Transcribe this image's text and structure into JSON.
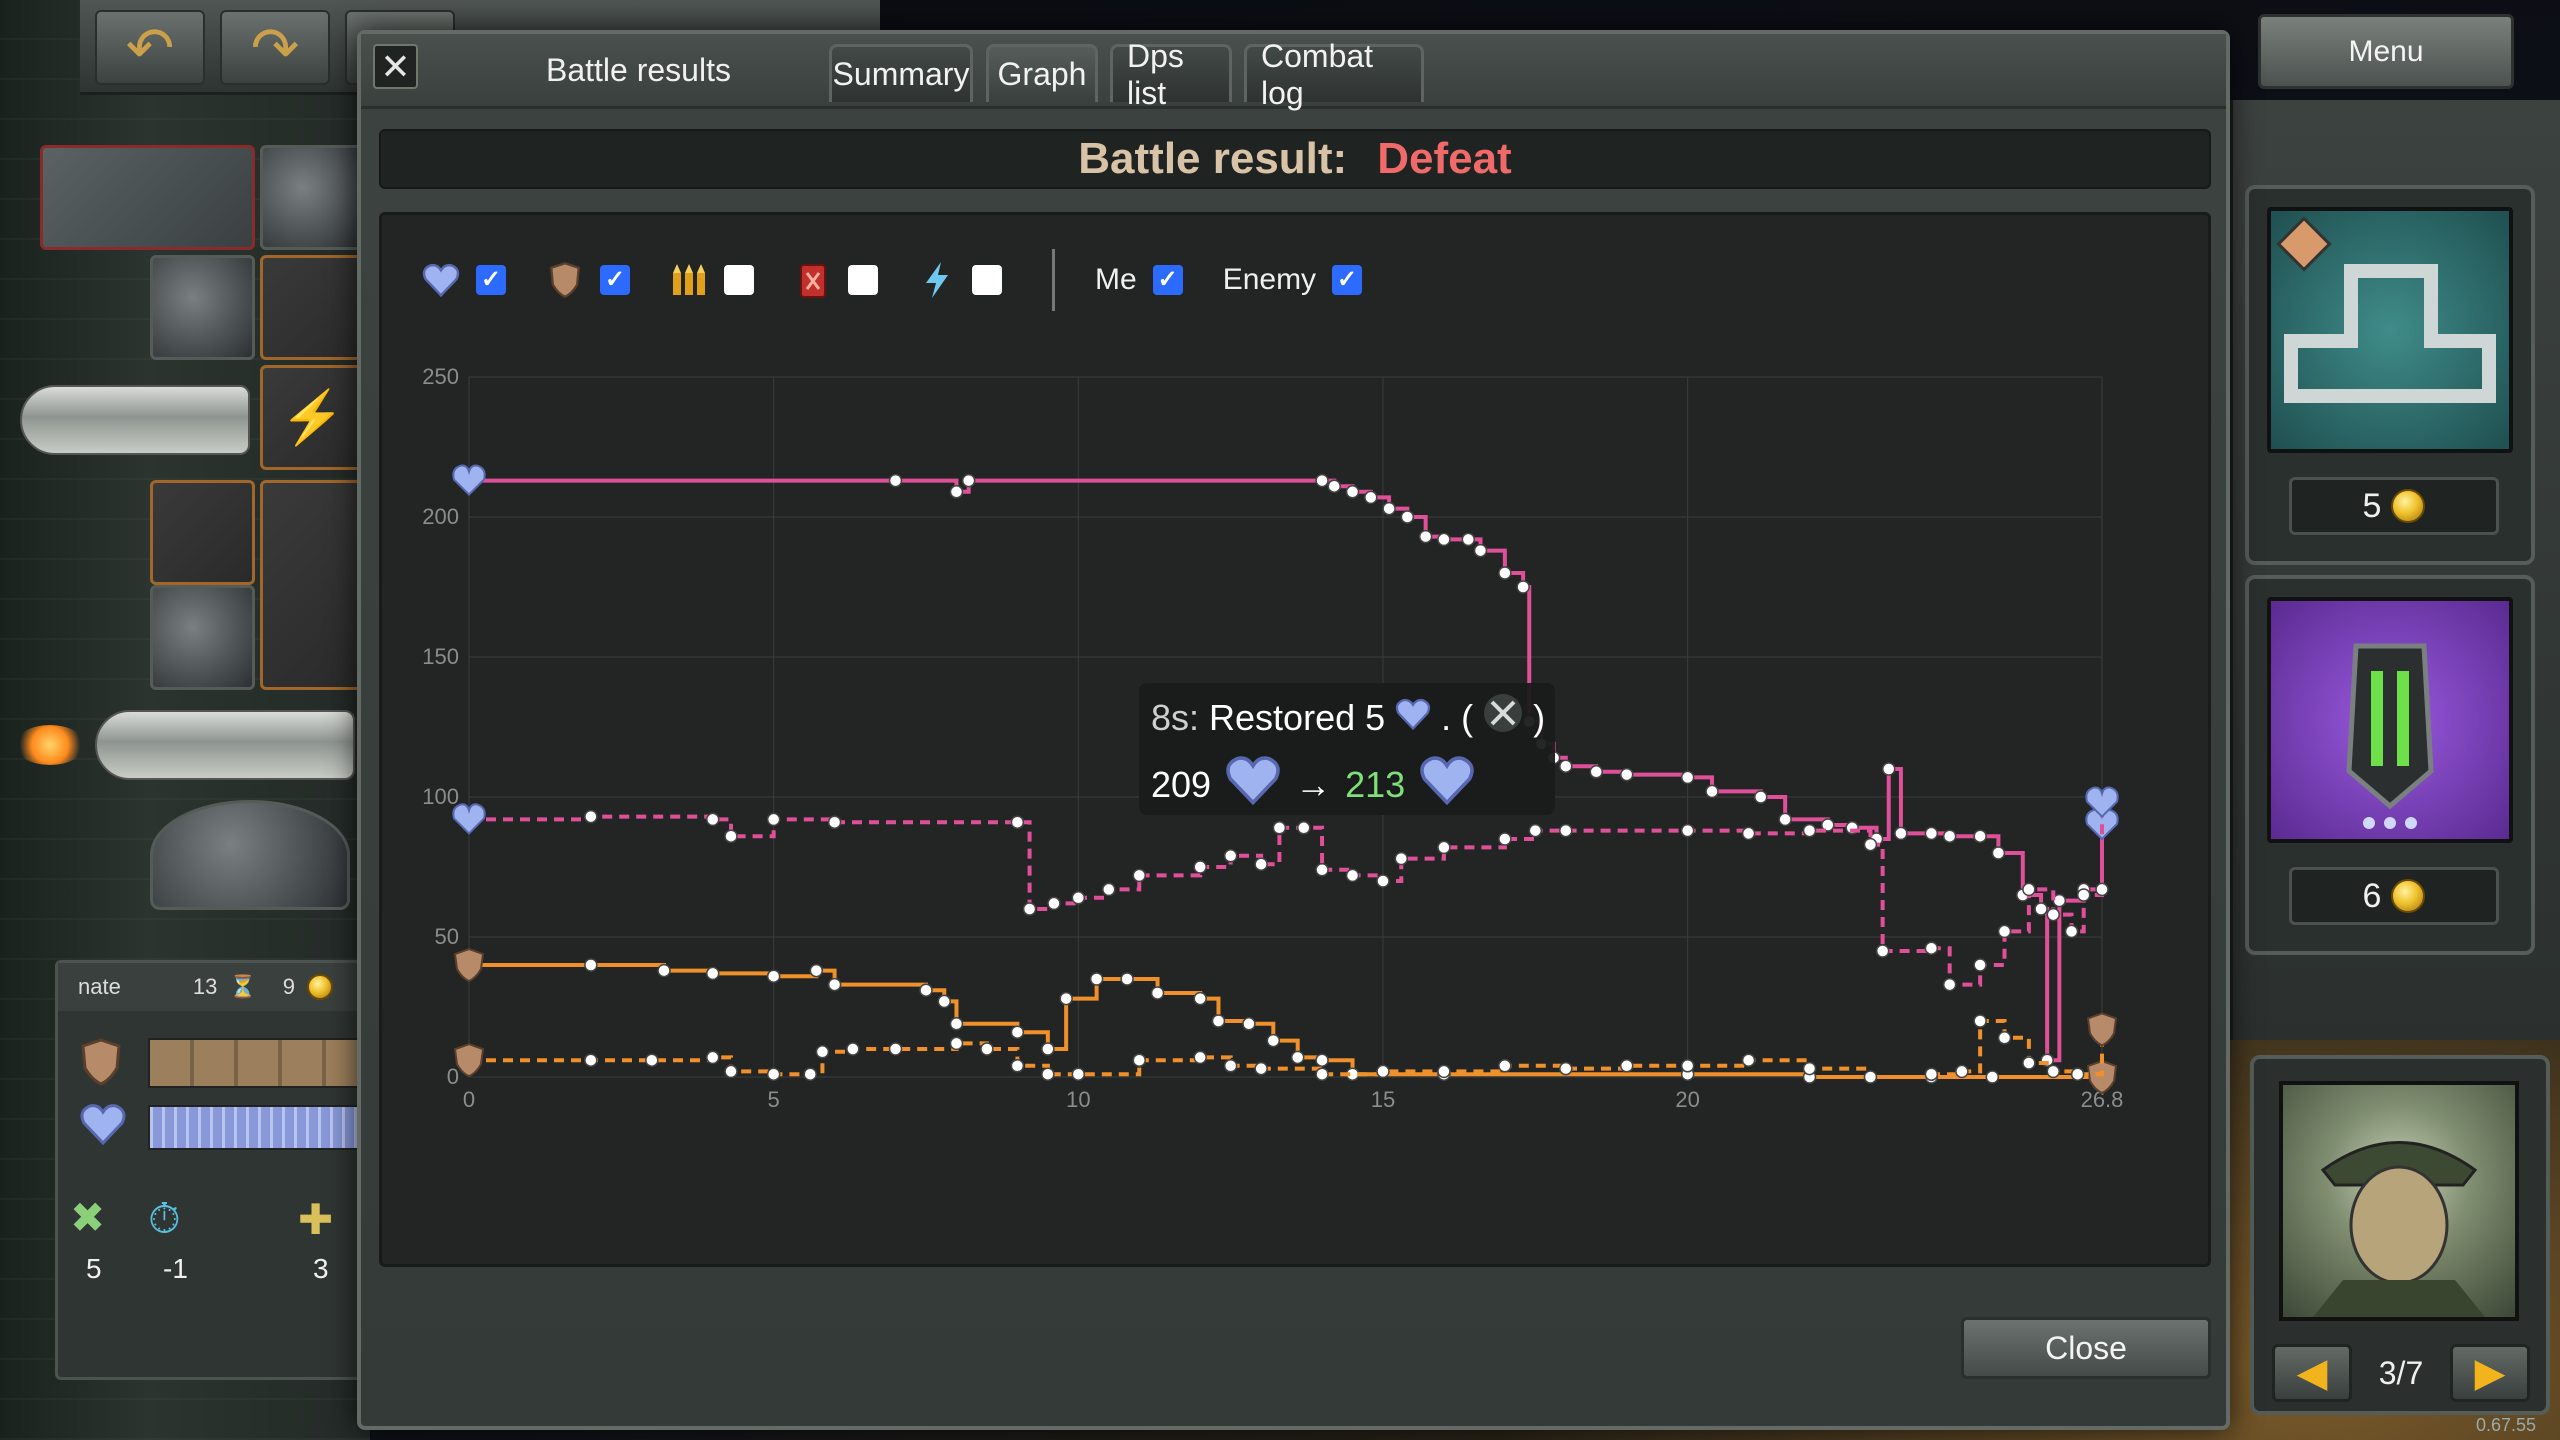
{
  "dialog": {
    "title": "Battle results",
    "tabs": [
      {
        "label": "Summary"
      },
      {
        "label": "Graph"
      },
      {
        "label": "Dps list"
      },
      {
        "label": "Combat log"
      }
    ],
    "active_tab": "Graph",
    "close_label": "Close",
    "result_label": "Battle result:",
    "result_value": "Defeat"
  },
  "filters": {
    "hp": {
      "icon": "heart-icon",
      "checked": true
    },
    "armor": {
      "icon": "shield-icon",
      "checked": true
    },
    "ammo": {
      "icon": "ammo-icon",
      "checked": false
    },
    "fuel": {
      "icon": "fuel-icon",
      "checked": false
    },
    "energy": {
      "icon": "lightning-icon",
      "checked": false
    },
    "me": {
      "label": "Me",
      "checked": true
    },
    "enemy": {
      "label": "Enemy",
      "checked": true
    }
  },
  "tooltip": {
    "time": "8s:",
    "text": "Restored 5",
    "suffix": ". (",
    "close_paren": ")",
    "from": "209",
    "arrow": "→",
    "to": "213"
  },
  "colors": {
    "me": "#e0509a",
    "enemy": "#f0902a",
    "defeat": "#f06a6a",
    "heal_value": "#7fe07a"
  },
  "chart_data": {
    "type": "line",
    "xlim": [
      0,
      26.8
    ],
    "ylim": [
      0,
      250
    ],
    "x_ticks": [
      "0",
      "5",
      "10",
      "15",
      "20",
      "26.8"
    ],
    "y_ticks": [
      "0",
      "50",
      "100",
      "150",
      "200",
      "250"
    ],
    "grid": true,
    "series": [
      {
        "owner": "me",
        "stat": "hp",
        "style": "solid",
        "color": "#e0509a",
        "points": [
          [
            0,
            213
          ],
          [
            7,
            213
          ],
          [
            8,
            209
          ],
          [
            8.2,
            213
          ],
          [
            14,
            213
          ],
          [
            14.2,
            211
          ],
          [
            14.5,
            209
          ],
          [
            14.8,
            207
          ],
          [
            15.1,
            203
          ],
          [
            15.4,
            200
          ],
          [
            15.7,
            193
          ],
          [
            16,
            192
          ],
          [
            16.4,
            192
          ],
          [
            16.6,
            188
          ],
          [
            17,
            180
          ],
          [
            17.3,
            175
          ],
          [
            17.4,
            127
          ],
          [
            17.6,
            119
          ],
          [
            17.8,
            114
          ],
          [
            18,
            111
          ],
          [
            18.5,
            109
          ],
          [
            19,
            108
          ],
          [
            20,
            107
          ],
          [
            20.4,
            102
          ],
          [
            21.2,
            100
          ],
          [
            21.6,
            92
          ],
          [
            22.3,
            90
          ],
          [
            22.7,
            89
          ],
          [
            23.1,
            85
          ],
          [
            23.3,
            110
          ],
          [
            23.5,
            87
          ],
          [
            24,
            87
          ],
          [
            24.3,
            86
          ],
          [
            24.8,
            86
          ],
          [
            25.1,
            80
          ],
          [
            25.5,
            65
          ],
          [
            25.8,
            60
          ],
          [
            25.9,
            6
          ],
          [
            26.1,
            63
          ],
          [
            26.5,
            67
          ],
          [
            26.8,
            90
          ]
        ]
      },
      {
        "owner": "me",
        "stat": "armor",
        "style": "solid",
        "color": "#f0902a",
        "points": [
          [
            0,
            40
          ],
          [
            2,
            40
          ],
          [
            3.2,
            38
          ],
          [
            4,
            37
          ],
          [
            5,
            36
          ],
          [
            5.7,
            38
          ],
          [
            6,
            33
          ],
          [
            7.5,
            31
          ],
          [
            7.8,
            27
          ],
          [
            8,
            19
          ],
          [
            9,
            16
          ],
          [
            9.5,
            10
          ],
          [
            9.8,
            28
          ],
          [
            10.3,
            35
          ],
          [
            10.8,
            35
          ],
          [
            11.3,
            30
          ],
          [
            12,
            28
          ],
          [
            12.3,
            20
          ],
          [
            12.8,
            19
          ],
          [
            13.2,
            13
          ],
          [
            13.6,
            7
          ],
          [
            14,
            6
          ],
          [
            14.5,
            1
          ],
          [
            16,
            1
          ],
          [
            20,
            1
          ],
          [
            22,
            0
          ],
          [
            24,
            0
          ],
          [
            25,
            0
          ],
          [
            26.8,
            0
          ]
        ]
      },
      {
        "owner": "enemy",
        "stat": "hp",
        "style": "dashed",
        "color": "#e0509a",
        "points": [
          [
            0,
            92
          ],
          [
            2,
            93
          ],
          [
            4,
            92
          ],
          [
            4.3,
            86
          ],
          [
            5,
            92
          ],
          [
            6,
            91
          ],
          [
            9,
            91
          ],
          [
            9.2,
            60
          ],
          [
            9.6,
            62
          ],
          [
            10,
            64
          ],
          [
            10.5,
            67
          ],
          [
            11,
            72
          ],
          [
            12,
            75
          ],
          [
            12.5,
            79
          ],
          [
            13,
            76
          ],
          [
            13.3,
            89
          ],
          [
            13.7,
            89
          ],
          [
            14,
            74
          ],
          [
            14.5,
            72
          ],
          [
            15,
            70
          ],
          [
            15.3,
            78
          ],
          [
            16,
            82
          ],
          [
            17,
            85
          ],
          [
            17.5,
            88
          ],
          [
            18,
            88
          ],
          [
            20,
            88
          ],
          [
            21,
            87
          ],
          [
            22,
            88
          ],
          [
            23,
            83
          ],
          [
            23.2,
            45
          ],
          [
            24,
            46
          ],
          [
            24.3,
            33
          ],
          [
            24.8,
            40
          ],
          [
            25.2,
            52
          ],
          [
            25.6,
            67
          ],
          [
            26,
            58
          ],
          [
            26.3,
            52
          ],
          [
            26.5,
            65
          ],
          [
            26.8,
            67
          ],
          [
            26.8,
            98
          ]
        ]
      },
      {
        "owner": "enemy",
        "stat": "armor",
        "style": "dashed",
        "color": "#f0902a",
        "points": [
          [
            0,
            6
          ],
          [
            2,
            6
          ],
          [
            3,
            6
          ],
          [
            4,
            7
          ],
          [
            4.3,
            2
          ],
          [
            5,
            1
          ],
          [
            5.6,
            1
          ],
          [
            5.8,
            9
          ],
          [
            6.3,
            10
          ],
          [
            7,
            10
          ],
          [
            8,
            12
          ],
          [
            8.5,
            10
          ],
          [
            9,
            4
          ],
          [
            9.5,
            1
          ],
          [
            10,
            1
          ],
          [
            11,
            6
          ],
          [
            12,
            7
          ],
          [
            12.5,
            4
          ],
          [
            13,
            3
          ],
          [
            14,
            1
          ],
          [
            15,
            2
          ],
          [
            16,
            2
          ],
          [
            17,
            4
          ],
          [
            18,
            3
          ],
          [
            19,
            4
          ],
          [
            20,
            4
          ],
          [
            21,
            6
          ],
          [
            22,
            3
          ],
          [
            23,
            0
          ],
          [
            24,
            1
          ],
          [
            24.5,
            2
          ],
          [
            24.8,
            20
          ],
          [
            25.2,
            14
          ],
          [
            25.6,
            5
          ],
          [
            26,
            2
          ],
          [
            26.4,
            1
          ],
          [
            26.8,
            17
          ]
        ]
      }
    ]
  },
  "left_panel": {
    "name_fragment": "nate",
    "time_value": "13",
    "gold_value": "9",
    "repair_value": "5",
    "timer_value": "-1",
    "buff_value": "3"
  },
  "shop": {
    "cards": [
      {
        "price": "5",
        "icon": "pipe-module-icon",
        "bg": "#2a6b6b"
      },
      {
        "price": "6",
        "icon": "energy-cell-icon",
        "bg": "#7a3fc0"
      }
    ]
  },
  "captain": {
    "page": "3/7"
  },
  "menu_label": "Menu",
  "version": "0.67.55"
}
